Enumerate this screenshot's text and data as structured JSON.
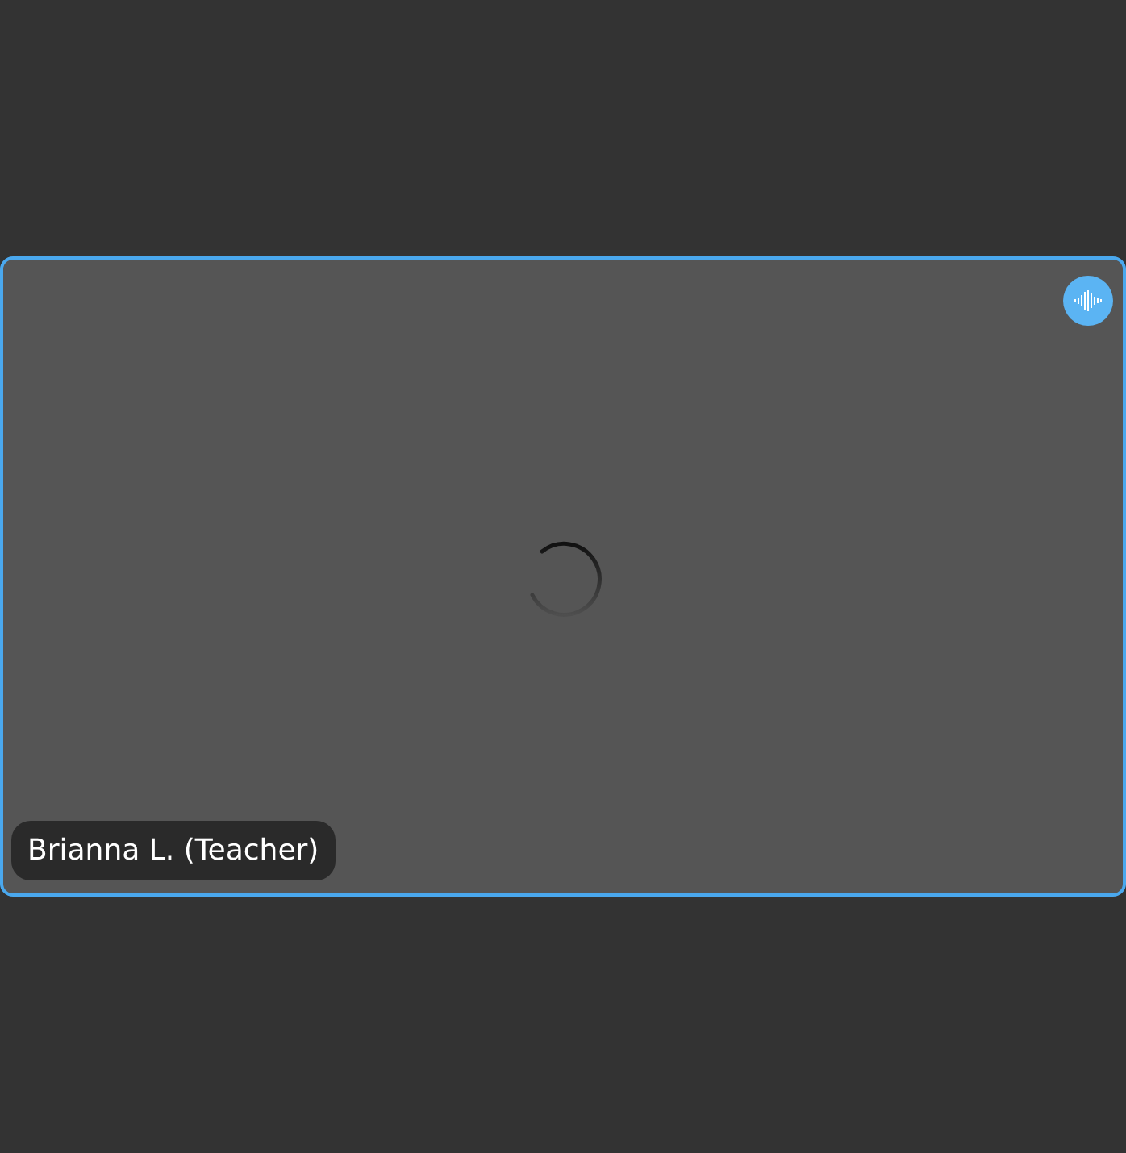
{
  "video_tile": {
    "participant_name": "Brianna L. (Teacher)",
    "speaking": true,
    "loading": true
  }
}
